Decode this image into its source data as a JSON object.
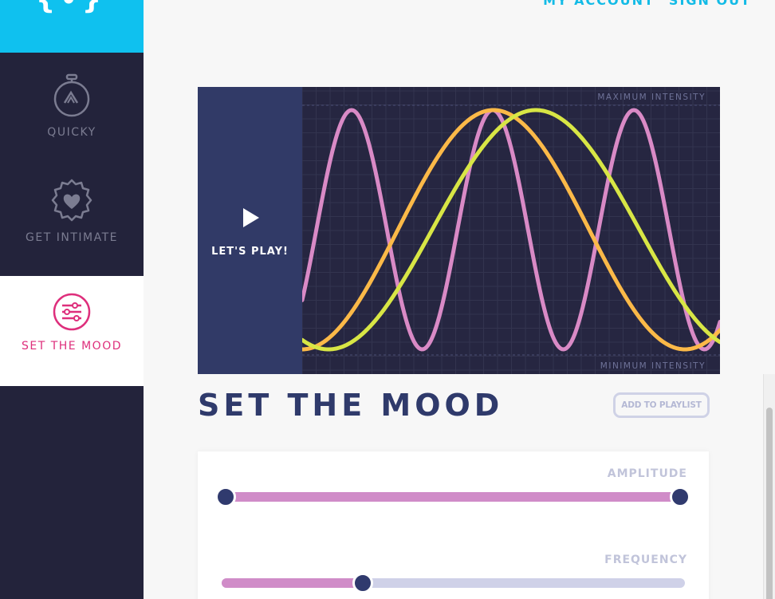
{
  "brand": {
    "logo_text": "{•}"
  },
  "header": {
    "account_link": "MY ACCOUNT",
    "signout_link": "SIGN OUT"
  },
  "sidebar": {
    "items": [
      {
        "label": "QUICKY",
        "icon": "stopwatch-icon",
        "active": false
      },
      {
        "label": "GET INTIMATE",
        "icon": "heart-badge-icon",
        "active": false
      },
      {
        "label": "SET THE MOOD",
        "icon": "sliders-icon",
        "active": true
      }
    ]
  },
  "player": {
    "play_label": "LET'S PLAY!",
    "max_label": "MAXIMUM INTENSITY",
    "min_label": "MINIMUM INTENSITY",
    "colors": {
      "pink": "#d98ac6",
      "orange": "#fbb948",
      "lime": "#d8e645",
      "background": "#262641",
      "play_panel": "#313a67"
    }
  },
  "main": {
    "title": "SET THE MOOD",
    "playlist_button": "ADD TO PLAYLIST"
  },
  "controls": {
    "amplitude": {
      "label": "AMPLITUDE",
      "low": 0,
      "high": 1
    },
    "frequency": {
      "label": "FREQUENCY",
      "value": 0.3
    }
  },
  "colors": {
    "accent": "#0fc1ef",
    "brand_pink": "#de2f7c",
    "title": "#2f3a6b",
    "sidebar": "#23233b"
  }
}
